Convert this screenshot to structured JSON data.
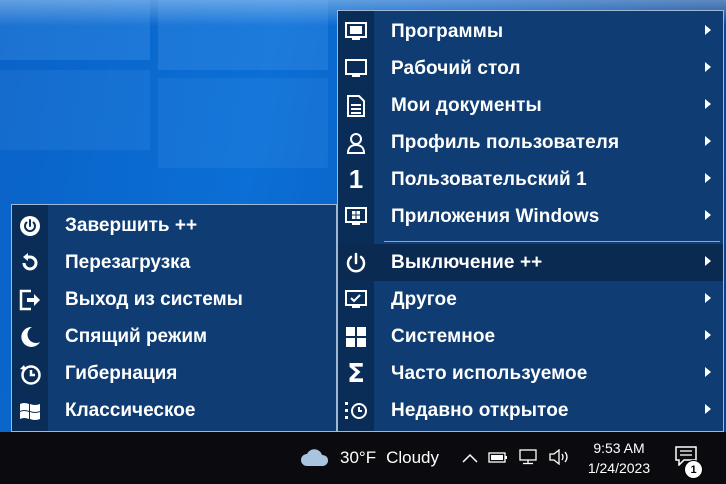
{
  "main_menu": {
    "items": [
      {
        "label": "Программы",
        "icon": "monitor-window-icon"
      },
      {
        "label": "Рабочий стол",
        "icon": "monitor-icon"
      },
      {
        "label": "Мои документы",
        "icon": "document-icon"
      },
      {
        "label": "Профиль пользователя",
        "icon": "user-icon"
      },
      {
        "label": "Пользовательский 1",
        "icon": "number-one-icon",
        "glyph": "1"
      },
      {
        "label": "Приложения Windows",
        "icon": "windows-apps-icon"
      },
      {
        "label": "Выключение ++",
        "icon": "power-icon",
        "active": true
      },
      {
        "label": "Другое",
        "icon": "checkmark-monitor-icon"
      },
      {
        "label": "Системное",
        "icon": "windows-logo-icon"
      },
      {
        "label": "Часто используемое",
        "icon": "sigma-icon",
        "glyph": "Σ"
      },
      {
        "label": "Недавно открытое",
        "icon": "recent-clock-icon"
      }
    ]
  },
  "submenu": {
    "items": [
      {
        "label": "Завершить ++",
        "icon": "power-circle-icon"
      },
      {
        "label": "Перезагрузка",
        "icon": "restart-icon"
      },
      {
        "label": "Выход из системы",
        "icon": "logout-icon"
      },
      {
        "label": "Спящий режим",
        "icon": "moon-icon"
      },
      {
        "label": "Гибернация",
        "icon": "hibernate-clock-icon"
      },
      {
        "label": "Классическое",
        "icon": "windows-classic-flag-icon"
      }
    ]
  },
  "taskbar": {
    "weather_temp": "30°F",
    "weather_desc": "Cloudy",
    "time": "9:53 AM",
    "date": "1/24/2023",
    "notification_count": "1"
  },
  "colors": {
    "menu_bg": "#0e3c73",
    "icon_column": "#0a2d57",
    "active_item": "#0a2a52",
    "taskbar": "#0b0b0f"
  }
}
